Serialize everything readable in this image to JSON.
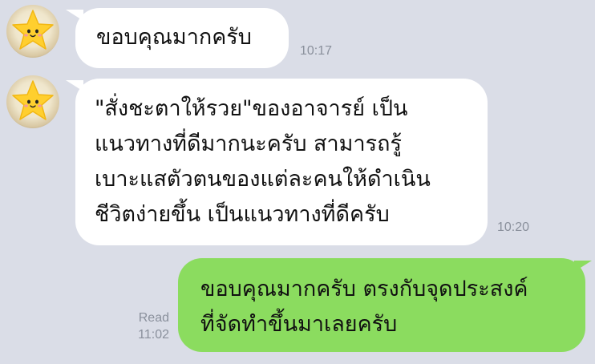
{
  "messages": [
    {
      "direction": "incoming",
      "avatar_icon": "star-face-icon",
      "lines": [
        "ขอบคุณมากครับ"
      ],
      "time": "10:17"
    },
    {
      "direction": "incoming",
      "avatar_icon": "star-face-icon",
      "lines": [
        "\"สั่งชะตาให้รวย\"ของอาจารย์ เป็น",
        "แนวทางที่ดีมากนะครับ สามารถรู้",
        "เบาะแสตัวตนของแต่ละคนให้ดำเนิน",
        "ชีวิตง่ายขึ้น เป็นแนวทางที่ดีครับ"
      ],
      "time": "10:20"
    },
    {
      "direction": "outgoing",
      "lines": [
        "ขอบคุณมากครับ ตรงกับจุดประสงค์",
        "ที่จัดทำขึ้นมาเลยครับ"
      ],
      "read_label": "Read",
      "time": "11:02"
    }
  ],
  "colors": {
    "background": "#dadde7",
    "incoming_bubble": "#ffffff",
    "outgoing_bubble": "#8bdc5f",
    "timestamp": "#8a909c"
  }
}
